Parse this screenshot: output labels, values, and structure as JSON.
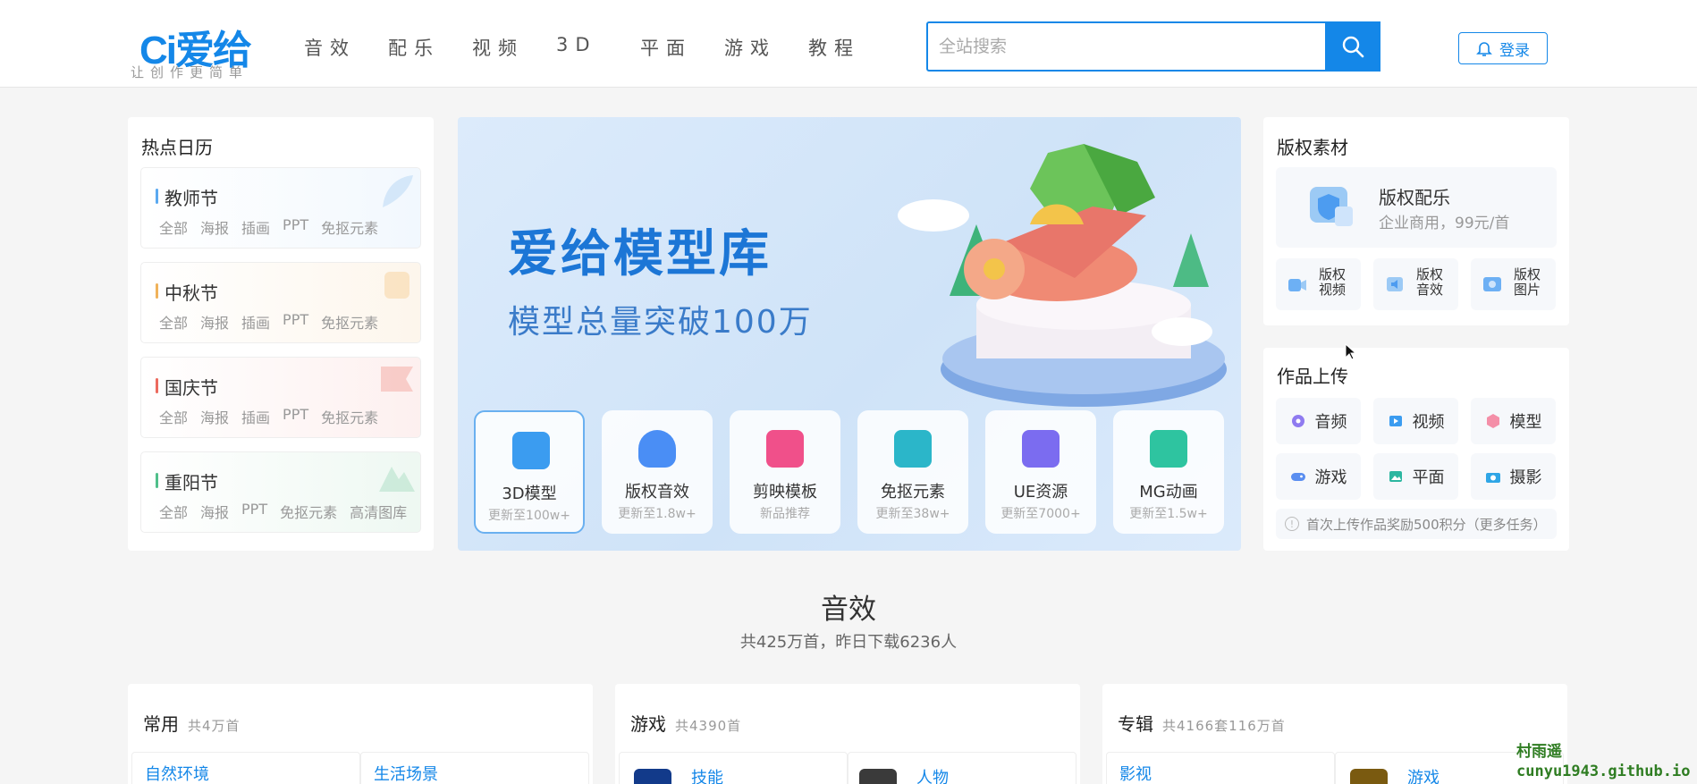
{
  "header": {
    "logo_text": "Ci爱给",
    "slogan": "让创作更简单",
    "nav": [
      "音效",
      "配乐",
      "视频",
      "3D",
      "平面",
      "游戏",
      "教程"
    ],
    "search_placeholder": "全站搜索",
    "login_label": "登录"
  },
  "calendar": {
    "title": "热点日历",
    "items": [
      {
        "name": "教师节",
        "color": "#5aa9f0",
        "tags": [
          "全部",
          "海报",
          "插画",
          "PPT",
          "免抠元素"
        ]
      },
      {
        "name": "中秋节",
        "color": "#f0b25a",
        "tags": [
          "全部",
          "海报",
          "插画",
          "PPT",
          "免抠元素"
        ]
      },
      {
        "name": "国庆节",
        "color": "#ec6a5e",
        "tags": [
          "全部",
          "海报",
          "插画",
          "PPT",
          "免抠元素"
        ]
      },
      {
        "name": "重阳节",
        "color": "#4fbf8a",
        "tags": [
          "全部",
          "海报",
          "PPT",
          "免抠元素",
          "高清图库"
        ]
      }
    ]
  },
  "banner": {
    "title": "爱给模型库",
    "subtitle": "模型总量突破100万",
    "categories": [
      {
        "name": "3D模型",
        "sub": "更新至100w+",
        "color": "#3b9cf0"
      },
      {
        "name": "版权音效",
        "sub": "更新至1.8w+",
        "color": "#4a8ef5"
      },
      {
        "name": "剪映模板",
        "sub": "新品推荐",
        "color": "#f0508a"
      },
      {
        "name": "免抠元素",
        "sub": "更新至38w+",
        "color": "#2bb6c9"
      },
      {
        "name": "UE资源",
        "sub": "更新至7000+",
        "color": "#7b6cf0"
      },
      {
        "name": "MG动画",
        "sub": "更新至1.5w+",
        "color": "#2ec4a0"
      }
    ]
  },
  "copyright": {
    "title": "版权素材",
    "main_title": "版权配乐",
    "main_sub": "企业商用，99元/首",
    "minis": [
      {
        "line1": "版权",
        "line2": "视频"
      },
      {
        "line1": "版权",
        "line2": "音效"
      },
      {
        "line1": "版权",
        "line2": "图片"
      }
    ]
  },
  "upload": {
    "title": "作品上传",
    "items": [
      "音频",
      "视频",
      "模型",
      "游戏",
      "平面",
      "摄影"
    ],
    "tip": "首次上传作品奖励500积分（更多任务）"
  },
  "section": {
    "title": "音效",
    "subtitle": "共425万首，昨日下载6236人"
  },
  "panels": [
    {
      "title": "常用",
      "count": "共4万首",
      "cells": [
        "自然环境",
        "生活场景"
      ]
    },
    {
      "title": "游戏",
      "count": "共4390首",
      "cells": [
        "技能",
        "人物"
      ]
    },
    {
      "title": "专辑",
      "count": "共4166套116万首",
      "cells": [
        "影视",
        "游戏"
      ]
    }
  ],
  "watermark": {
    "line1": "村雨遥",
    "line2": "cunyu1943.github.io"
  }
}
